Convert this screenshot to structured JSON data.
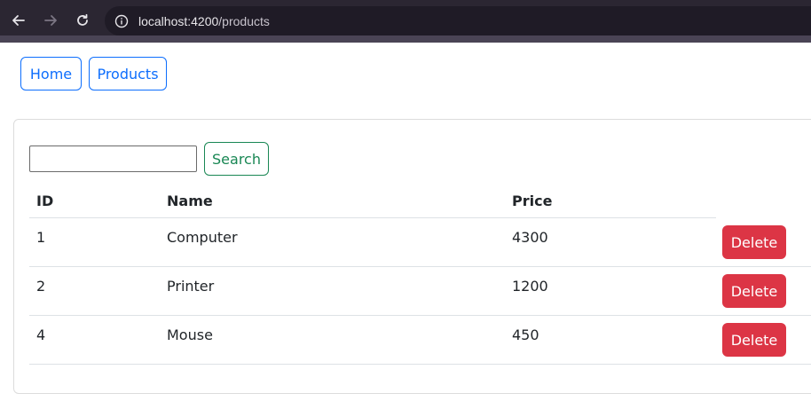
{
  "browser": {
    "url_host": "localhost:4200",
    "url_path": "/products"
  },
  "nav": {
    "home_label": "Home",
    "products_label": "Products"
  },
  "search": {
    "value": "",
    "button_label": "Search"
  },
  "table": {
    "headers": [
      "ID",
      "Name",
      "Price"
    ],
    "rows": [
      {
        "id": "1",
        "name": "Computer",
        "price": "4300",
        "action": "Delete"
      },
      {
        "id": "2",
        "name": "Printer",
        "price": "1200",
        "action": "Delete"
      },
      {
        "id": "4",
        "name": "Mouse",
        "price": "450",
        "action": "Delete"
      }
    ]
  },
  "colors": {
    "primary": "#0d6efd",
    "success": "#198754",
    "danger": "#dc3545",
    "browser_chrome": "#2b2632"
  }
}
